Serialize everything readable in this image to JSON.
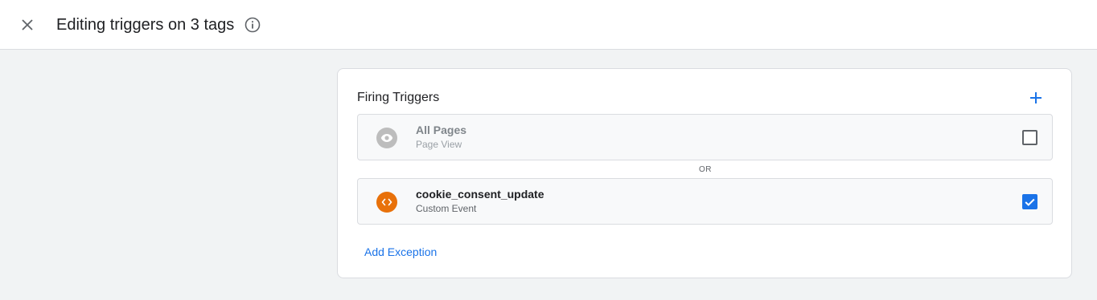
{
  "header": {
    "title": "Editing triggers on 3 tags",
    "close_icon": "close-icon",
    "info_icon": "info-icon"
  },
  "card": {
    "title": "Firing Triggers",
    "add_icon": "plus-icon",
    "triggers": [
      {
        "name": "All Pages",
        "type": "Page View",
        "icon": "eye-icon",
        "icon_color": "#bdbdbd",
        "checked": false
      },
      {
        "name": "cookie_consent_update",
        "type": "Custom Event",
        "icon": "code-icon",
        "icon_color": "#e8710a",
        "checked": true
      }
    ],
    "separator": "OR",
    "add_exception_label": "Add Exception"
  },
  "colors": {
    "accent": "#1a73e8",
    "background": "#f1f3f4"
  }
}
